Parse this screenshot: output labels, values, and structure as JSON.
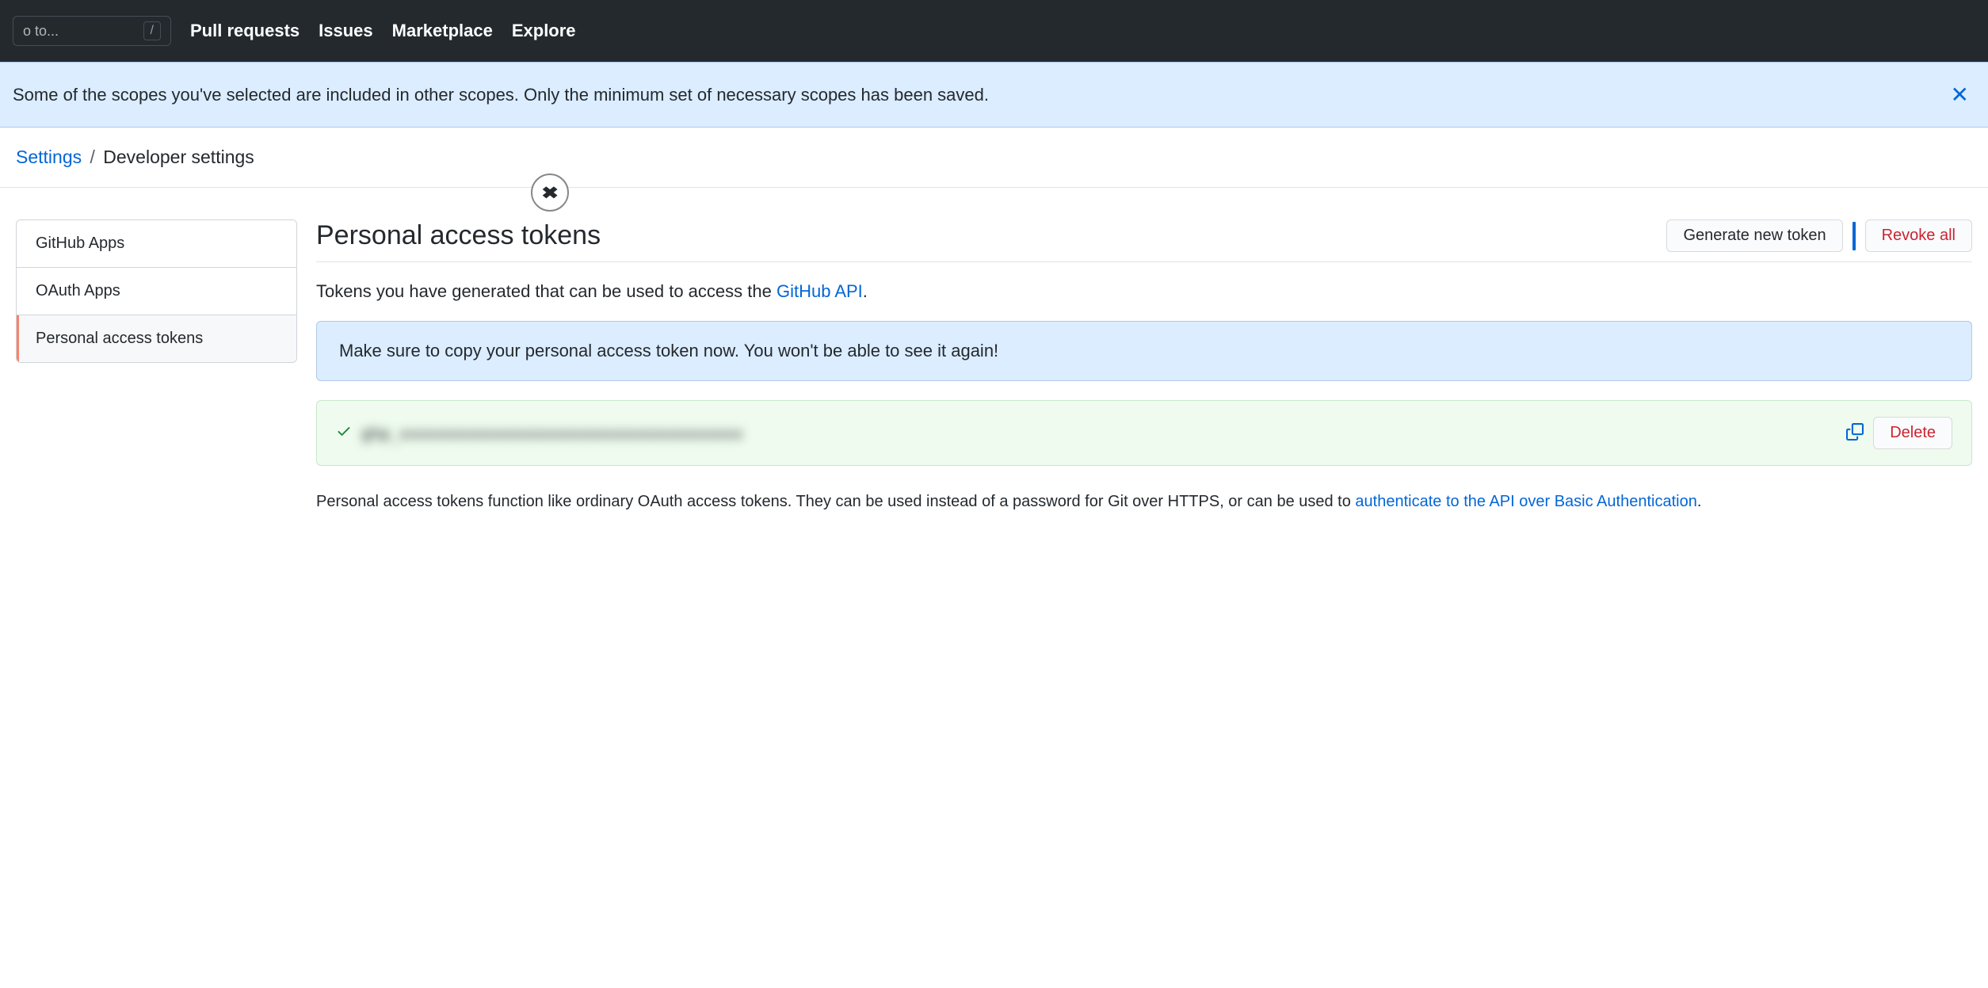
{
  "nav": {
    "search_placeholder": "o to...",
    "slash_key": "/",
    "links": [
      "Pull requests",
      "Issues",
      "Marketplace",
      "Explore"
    ]
  },
  "flash": {
    "message": "Some of the scopes you've selected are included in other scopes. Only the minimum set of necessary scopes has been saved."
  },
  "breadcrumb": {
    "parent": "Settings",
    "current": "Developer settings"
  },
  "sidebar": {
    "items": [
      {
        "label": "GitHub Apps",
        "active": false
      },
      {
        "label": "OAuth Apps",
        "active": false
      },
      {
        "label": "Personal access tokens",
        "active": true
      }
    ]
  },
  "main": {
    "title": "Personal access tokens",
    "generate_button": "Generate new token",
    "revoke_button": "Revoke all",
    "intro_prefix": "Tokens you have generated that can be used to access the ",
    "intro_link": "GitHub API",
    "intro_suffix": ".",
    "warning": "Make sure to copy your personal access token now. You won't be able to see it again!",
    "token_value": "ghp_xxxxxxxxxxxxxxxxxxxxxxxxxxxxxxxxxxxx",
    "delete_button": "Delete",
    "footer_prefix": "Personal access tokens function like ordinary OAuth access tokens. They can be used instead of a password for Git over HTTPS, or can be used to ",
    "footer_link": "authenticate to the API over Basic Authentication",
    "footer_suffix": "."
  }
}
